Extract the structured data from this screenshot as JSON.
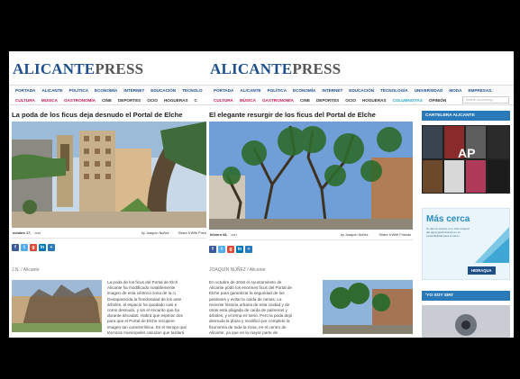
{
  "left": {
    "logo_a": "ALICANTE",
    "logo_b": "PRESS",
    "nav_top": [
      "PORTADA",
      "ALICANTE",
      "POLÍTICA",
      "ECONOMÍA",
      "INTERNET",
      "EDUCACIÓN",
      "TECNOLO"
    ],
    "nav_sub": [
      "CULTURA",
      "MÚSICA",
      "GASTRONOMÍA",
      "CINE",
      "DEPORTES",
      "OCIO",
      "HOGUERAS",
      "C"
    ],
    "headline": "La poda de los ficus deja desnudo el Portal de Elche",
    "date": "octubre 17,",
    "date2": "2016",
    "author": "by Joaquín Núñez",
    "share": "Share it With Frien",
    "byline": "J.N. / Alicante",
    "body": [
      "La poda de los ficus del Portal de Elch",
      "Alicante ha modificado notablemente",
      "imagen de esta céntrica zona de la ci",
      "Desaparecida la frondosidad de los ante",
      "árboles, el espacio ha quedado casi e",
      "como desnudo, y sin el encanto que ha",
      "durante décadas. Habrá que esperar dos",
      "para que el Portal de Elche recupere",
      "imagen tan característica. Es el tiempo que",
      "técnicos municipales calculan que tardará"
    ]
  },
  "right": {
    "logo_a": "ALICANTE",
    "logo_b": "PRESS",
    "nav_top": [
      "PORTADA",
      "ALICANTE",
      "POLÍTICA",
      "ECONOMÍA",
      "INTERNET",
      "EDUCACIÓN",
      "TECNOLOGÍA",
      "UNIVERSIDAD",
      "MODA",
      "EMPRESAS."
    ],
    "nav_sub": [
      "CULTURA",
      "MÚSICA",
      "GASTRONOMÍA",
      "CINE",
      "DEPORTES",
      "OCIO",
      "HOGUERAS",
      "COLUMNISTAS",
      "OPINIÓN"
    ],
    "search_placeholder": "Search something...",
    "headline": "El elegante resurgir de los ficus del Portal de Elche",
    "date": "febrero 08,",
    "date2": "2017",
    "author": "by Joaquín Núñez",
    "share": "Share it With Friends",
    "byline": "JOAQUÍN NÚÑEZ / Alicante",
    "body": [
      "En octubre de 2016 el Ayuntamiento de",
      "Alicante podó los enormes ficus del Portal de",
      "Elche para garantizar la seguridad de los",
      "peatones y evitar la caída de ramas. La",
      "reciente historia urbana de esta ciudad y de",
      "otras está plagada de caída de palmeras y",
      "árboles, y el tema es serio. Pero la poda dejó",
      "desnuda la plaza y modificó por completo la",
      "fisonomía de toda la zona, en el centro de",
      "Alicante, ya que en la mayor parte de"
    ],
    "sidebar_cartelera": "CARTELERA ALICANTE",
    "sidebar_yosoy": "'YO SOY SIRI'",
    "ad_mascerca": "Más cerca",
    "ad_text": "Te damos acceso a un ciclo integral del agua garantizando en su sostenibilidad para el futuro",
    "ad_brand": "HIDRAQUA"
  }
}
